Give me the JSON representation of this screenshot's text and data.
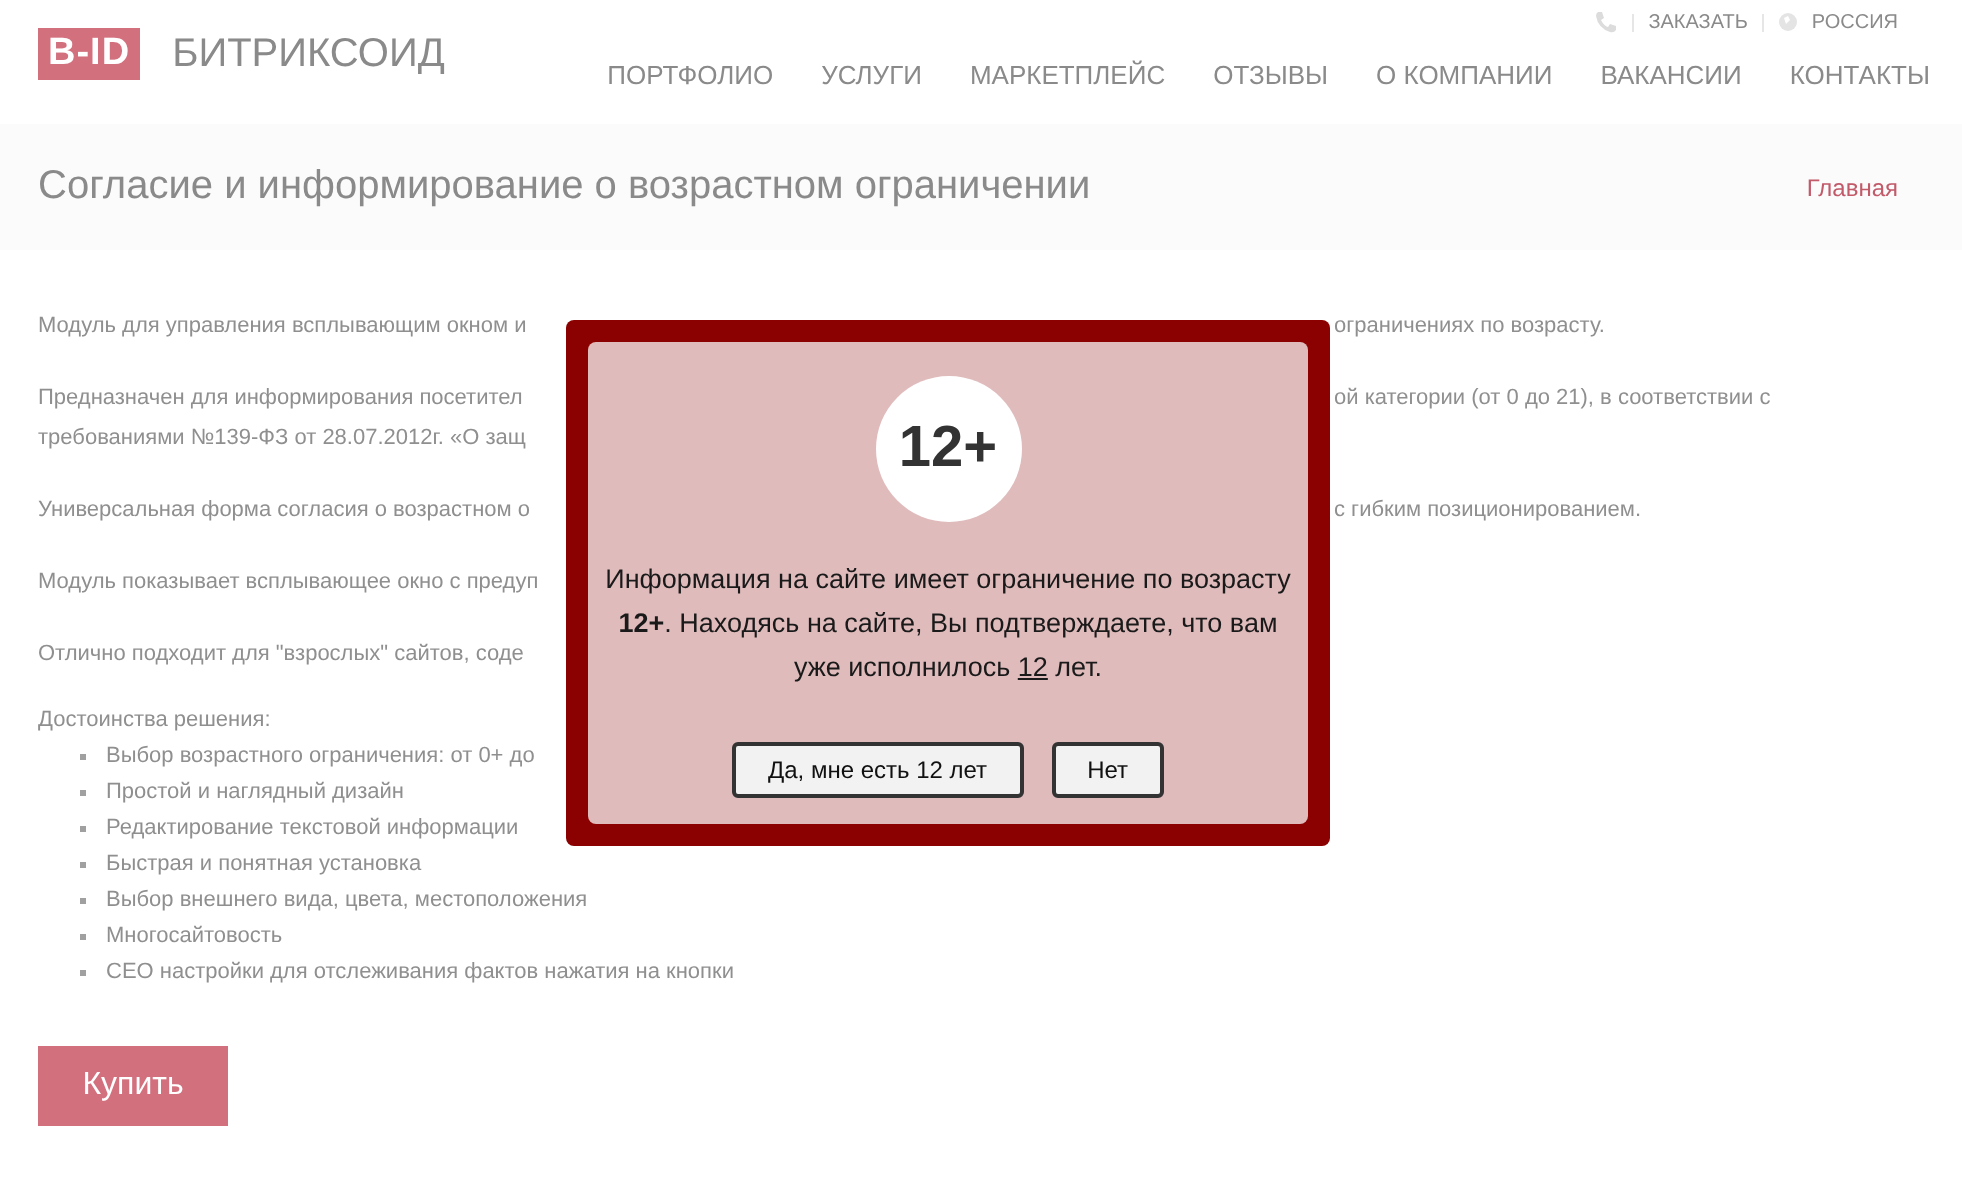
{
  "header": {
    "logo_badge": "B-ID",
    "logo_text": "БИТРИКСОИД",
    "order_link": "ЗАКАЗАТЬ",
    "region": "РОССИЯ",
    "nav": [
      "ПОРТФОЛИО",
      "УСЛУГИ",
      "МАРКЕТПЛЕЙС",
      "ОТЗЫВЫ",
      "О КОМПАНИИ",
      "ВАКАНСИИ",
      "КОНТАКТЫ"
    ]
  },
  "title_bar": {
    "title": "Согласие и информирование о возрастном ограничении",
    "breadcrumb": "Главная"
  },
  "content": {
    "paragraphs": [
      {
        "lines": [
          {
            "left": "Модуль для управления всплывающим окном и",
            "right": "ограничениях по возрасту."
          }
        ]
      },
      {
        "lines": [
          {
            "left": "Предназначен для информирования посетител",
            "right": "ой категории (от 0 до 21), в соответствии с"
          },
          {
            "left": "требованиями №139-ФЗ от 28.07.2012г. «О защ"
          }
        ]
      },
      {
        "lines": [
          {
            "left": "Универсальная форма согласия о возрастном о",
            "right": "с гибким позиционированием."
          }
        ]
      },
      {
        "lines": [
          {
            "left": "Модуль показывает всплывающее окно с предуп"
          }
        ]
      },
      {
        "lines": [
          {
            "left": "Отлично подходит для \"взрослых\" сайтов, соде"
          }
        ]
      }
    ],
    "features_heading": "Достоинства решения:",
    "features": [
      "Выбор возрастного ограничения: от 0+ до",
      "Простой и наглядный дизайн",
      "Редактирование текстовой информации",
      "Быстрая и понятная установка",
      "Выбор внешнего вида, цвета, местоположения",
      "Многосайтовость",
      "СЕО настройки для отслеживания фактов нажатия на кнопки"
    ],
    "buy_button": "Купить"
  },
  "modal": {
    "age_badge": "12+",
    "message": [
      {
        "text": "Информация на сайте имеет ограничение по возрасту ",
        "kind": "plain"
      },
      {
        "text": "12+",
        "kind": "bold"
      },
      {
        "text": ". Находясь на сайте, Вы подтверждаете, что вам уже исполнилось ",
        "kind": "plain"
      },
      {
        "text": "12",
        "kind": "underline"
      },
      {
        "text": " лет.",
        "kind": "plain"
      }
    ],
    "buttons": [
      "Да, мне есть 12 лет",
      "Нет"
    ]
  }
}
